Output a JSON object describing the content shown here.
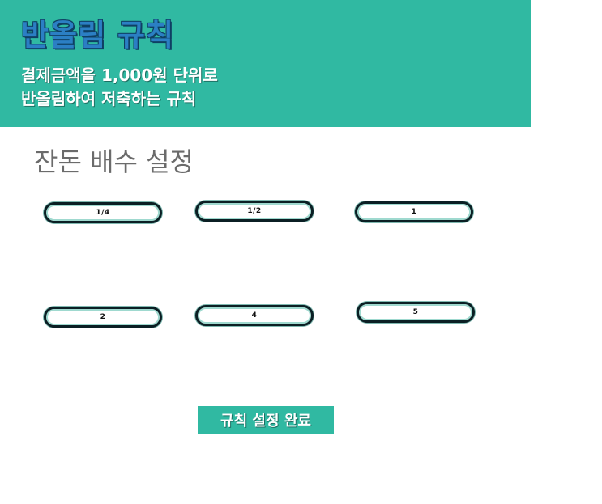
{
  "header": {
    "title": "반올림 규칙",
    "subtitle_line1": "결제금액을 1,000원 단위로",
    "subtitle_line2": "반올림하여 저축하는 규칙"
  },
  "multiplier": {
    "section_title": "잔돈 배수 설정",
    "options": [
      "1/4",
      "1/2",
      "1",
      "2",
      "4",
      "5"
    ]
  },
  "actions": {
    "complete_label": "규칙 설정 완료"
  },
  "colors": {
    "banner": "#30b9a2",
    "title": "#2b7fc4",
    "button_border": "#0b1f24"
  }
}
